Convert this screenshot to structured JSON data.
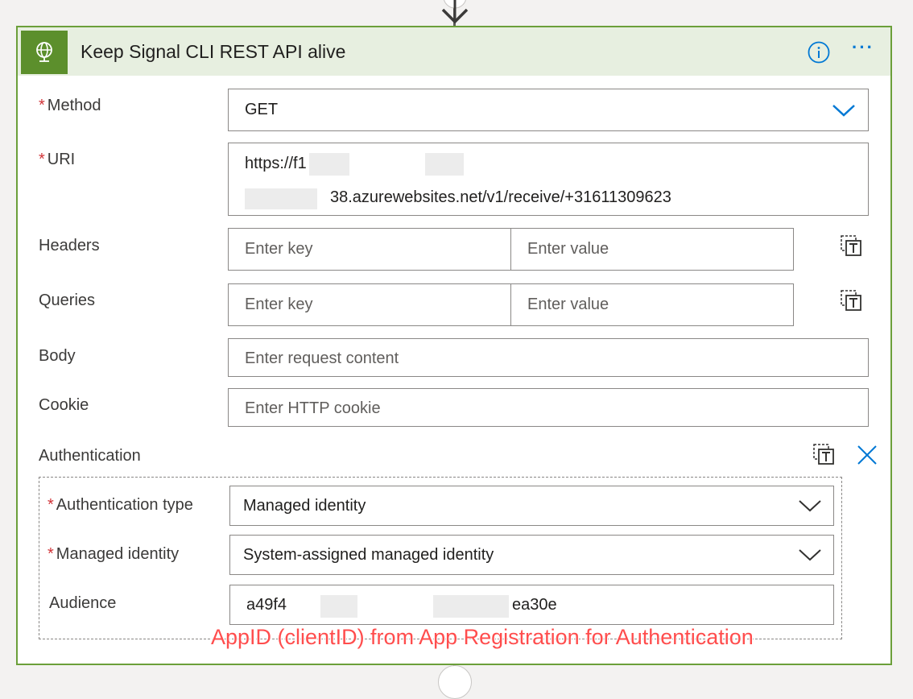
{
  "action": {
    "title": "Keep Signal CLI REST API alive",
    "icons": {
      "header": "globe-icon",
      "info": "info-icon",
      "more": "more-icon",
      "more_glyph": "···"
    }
  },
  "fields": {
    "method": {
      "label": "Method",
      "required": "*",
      "value": "GET"
    },
    "uri": {
      "label": "URI",
      "required": "*",
      "line1": "https://f1",
      "line2": "38.azurewebsites.net/v1/receive/+31611309623"
    },
    "headers": {
      "label": "Headers",
      "key_placeholder": "Enter key",
      "value_placeholder": "Enter value"
    },
    "queries": {
      "label": "Queries",
      "key_placeholder": "Enter key",
      "value_placeholder": "Enter value"
    },
    "body": {
      "label": "Body",
      "placeholder": "Enter request content"
    },
    "cookie": {
      "label": "Cookie",
      "placeholder": "Enter HTTP cookie"
    }
  },
  "authentication": {
    "label": "Authentication",
    "type": {
      "label": "Authentication type",
      "required": "*",
      "value": "Managed identity"
    },
    "identity": {
      "label": "Managed identity",
      "required": "*",
      "value": "System-assigned managed identity"
    },
    "audience": {
      "label": "Audience",
      "value_start": "a49f4",
      "value_end": "ea30e"
    }
  },
  "annotation": "AppID (clientID) from App Registration for Authentication",
  "colors": {
    "accent": "#0078d4",
    "header_bg": "#e7efe0",
    "card_border": "#6b9f3a",
    "icon_bg": "#5c8f2c",
    "required": "#d13438",
    "annotation": "#ff4d4d"
  }
}
